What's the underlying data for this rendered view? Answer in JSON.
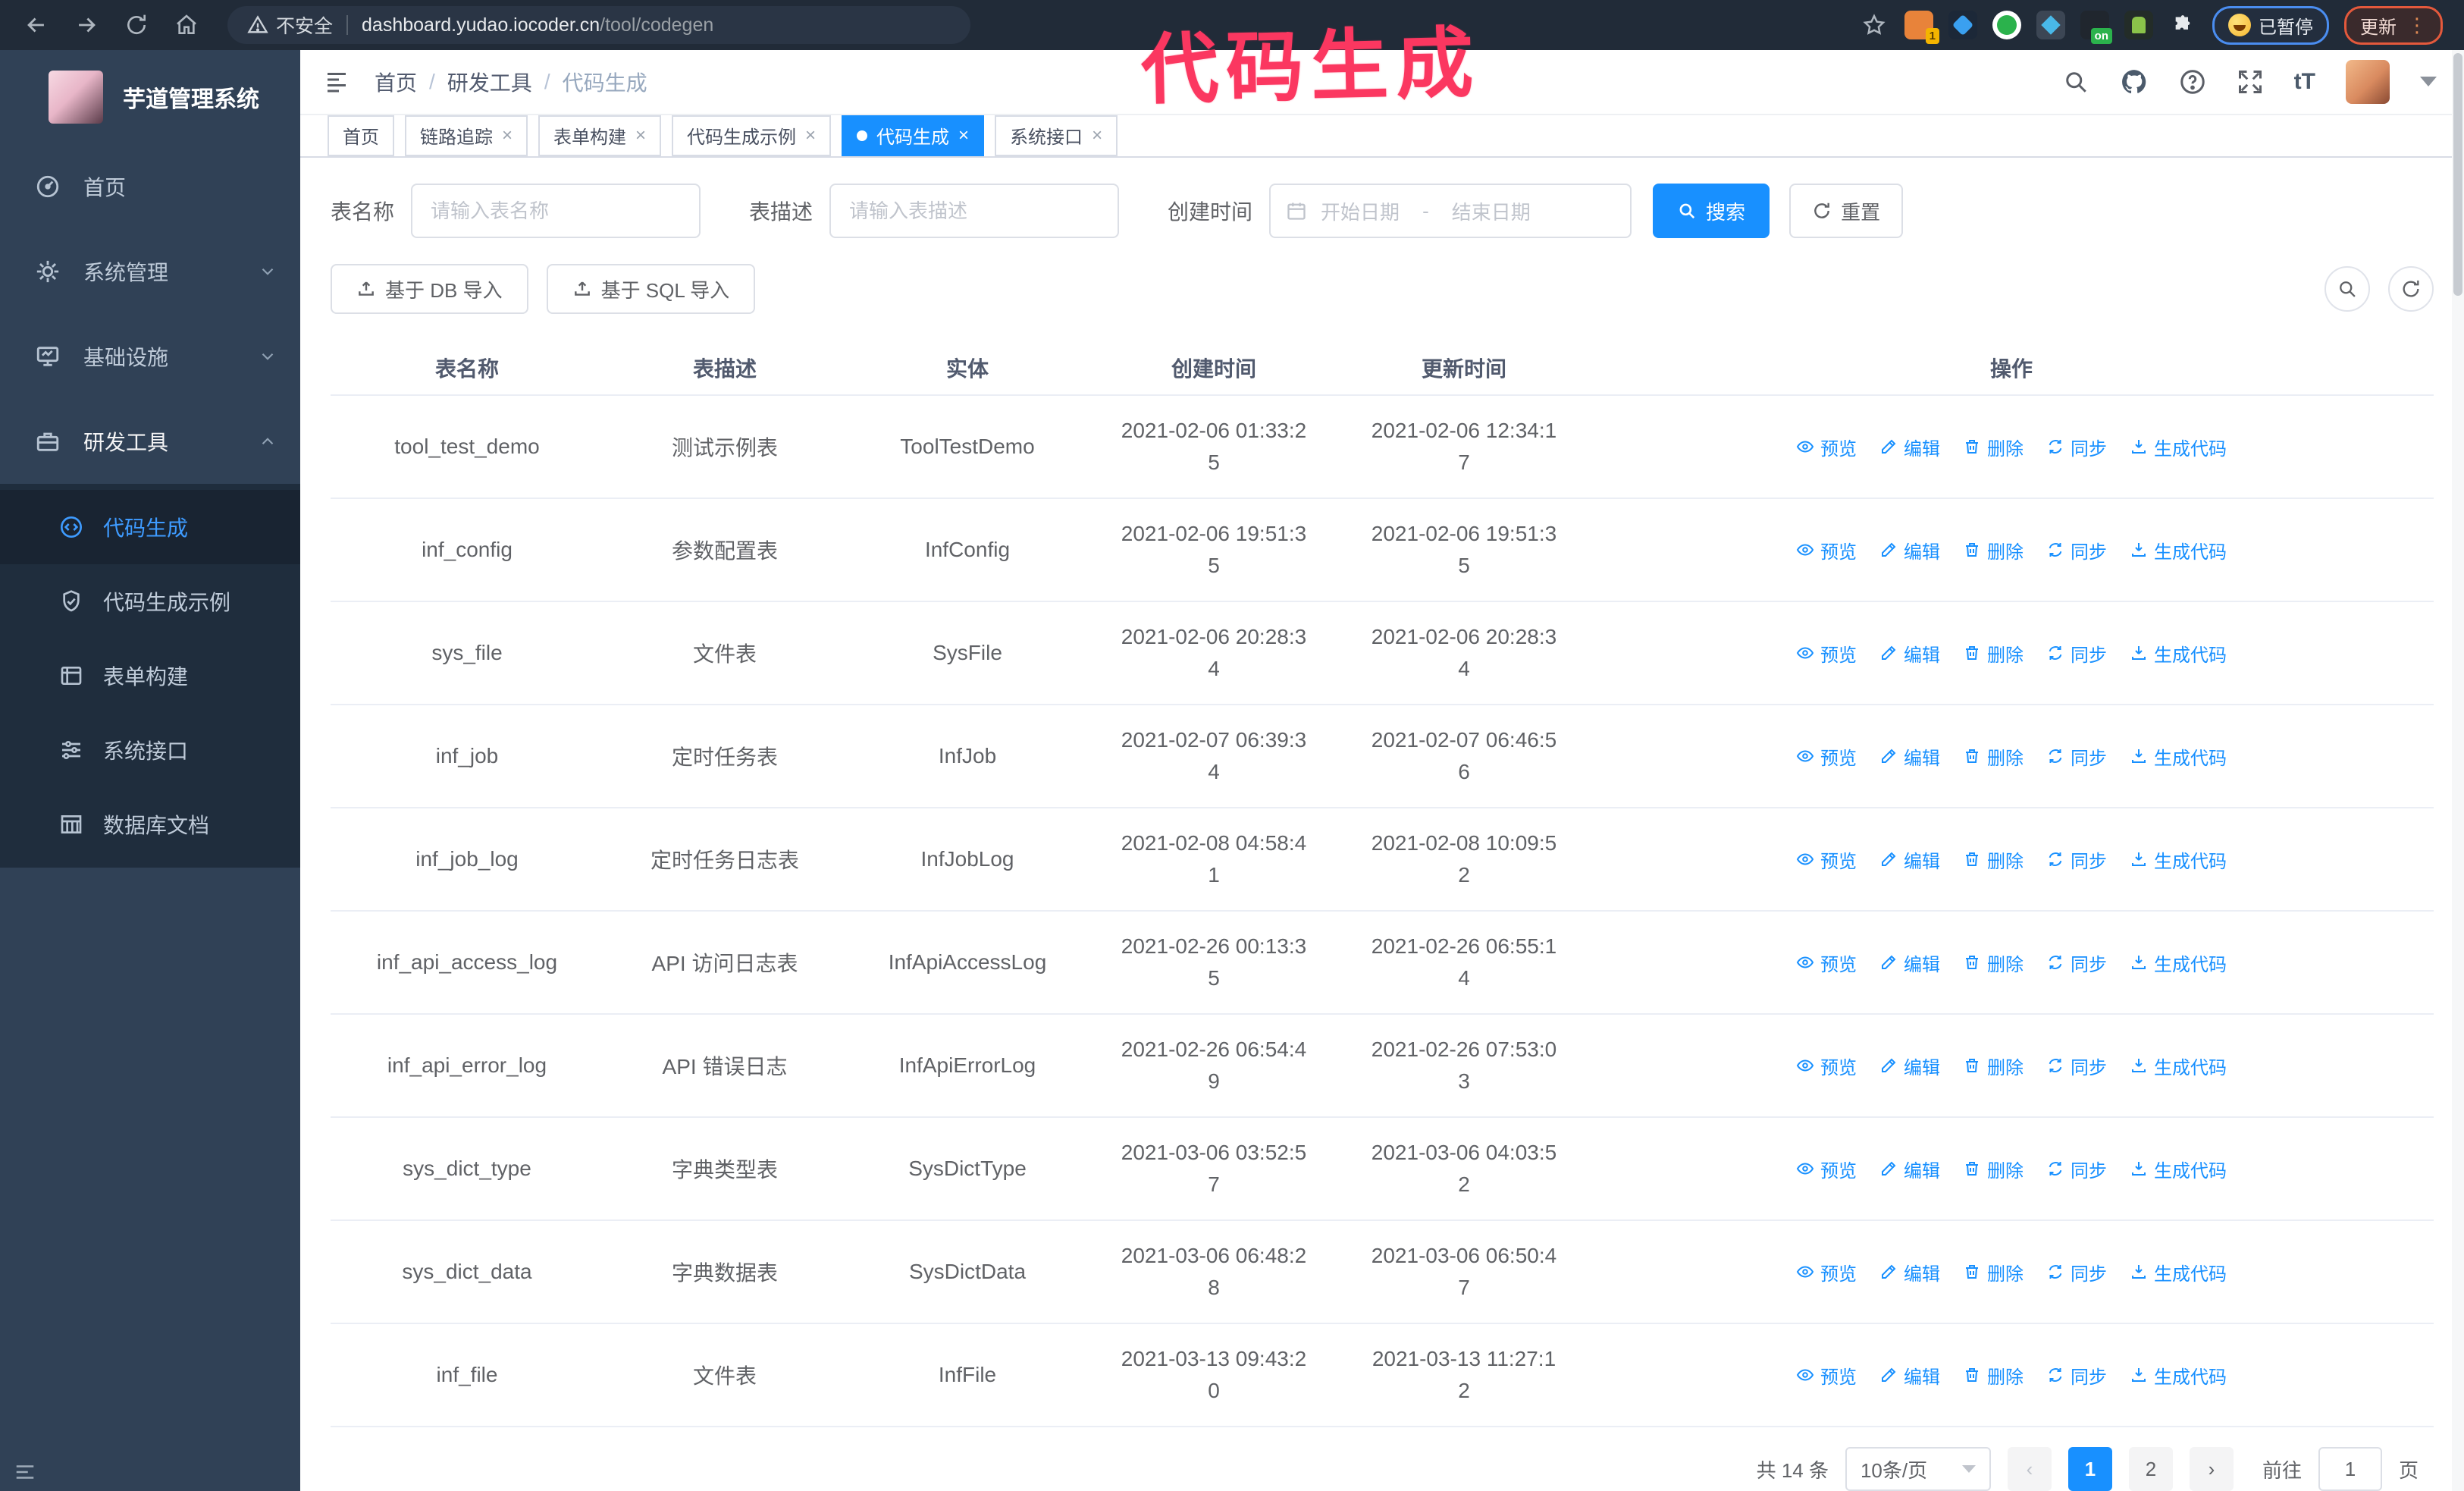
{
  "browser": {
    "security_label": "不安全",
    "url_host": "dashboard.yudao.iocoder.cn",
    "url_path": "/tool/codegen",
    "extension_badge_count": "1",
    "extension_badge_on": "on",
    "paused_badge": "已暂停",
    "update_button": "更新"
  },
  "annotation": {
    "text": "代码生成",
    "color": "#fb3760"
  },
  "sidebar": {
    "title": "芋道管理系统",
    "items": [
      {
        "label": "首页"
      },
      {
        "label": "系统管理"
      },
      {
        "label": "基础设施"
      },
      {
        "label": "研发工具"
      }
    ],
    "submenu": [
      {
        "label": "代码生成"
      },
      {
        "label": "代码生成示例"
      },
      {
        "label": "表单构建"
      },
      {
        "label": "系统接口"
      },
      {
        "label": "数据库文档"
      }
    ]
  },
  "navbar": {
    "breadcrumb": [
      "首页",
      "研发工具",
      "代码生成"
    ]
  },
  "tabs": [
    {
      "label": "首页"
    },
    {
      "label": "链路追踪"
    },
    {
      "label": "表单构建"
    },
    {
      "label": "代码生成示例"
    },
    {
      "label": "代码生成"
    },
    {
      "label": "系统接口"
    }
  ],
  "filters": {
    "table_name_label": "表名称",
    "table_name_placeholder": "请输入表名称",
    "table_desc_label": "表描述",
    "table_desc_placeholder": "请输入表描述",
    "create_time_label": "创建时间",
    "date_start_placeholder": "开始日期",
    "date_separator": "-",
    "date_end_placeholder": "结束日期",
    "search_button": "搜索",
    "reset_button": "重置"
  },
  "toolbar": {
    "import_db_button": "基于 DB 导入",
    "import_sql_button": "基于 SQL 导入"
  },
  "table": {
    "columns": [
      "表名称",
      "表描述",
      "实体",
      "创建时间",
      "更新时间",
      "操作"
    ],
    "actions": [
      "预览",
      "编辑",
      "删除",
      "同步",
      "生成代码"
    ],
    "rows": [
      {
        "name": "tool_test_demo",
        "desc": "测试示例表",
        "entity": "ToolTestDemo",
        "create_time": "2021-02-06 01:33:25",
        "update_time": "2021-02-06 12:34:17"
      },
      {
        "name": "inf_config",
        "desc": "参数配置表",
        "entity": "InfConfig",
        "create_time": "2021-02-06 19:51:35",
        "update_time": "2021-02-06 19:51:35"
      },
      {
        "name": "sys_file",
        "desc": "文件表",
        "entity": "SysFile",
        "create_time": "2021-02-06 20:28:34",
        "update_time": "2021-02-06 20:28:34"
      },
      {
        "name": "inf_job",
        "desc": "定时任务表",
        "entity": "InfJob",
        "create_time": "2021-02-07 06:39:34",
        "update_time": "2021-02-07 06:46:56"
      },
      {
        "name": "inf_job_log",
        "desc": "定时任务日志表",
        "entity": "InfJobLog",
        "create_time": "2021-02-08 04:58:41",
        "update_time": "2021-02-08 10:09:52"
      },
      {
        "name": "inf_api_access_log",
        "desc": "API 访问日志表",
        "entity": "InfApiAccessLog",
        "create_time": "2021-02-26 00:13:35",
        "update_time": "2021-02-26 06:55:14"
      },
      {
        "name": "inf_api_error_log",
        "desc": "API 错误日志",
        "entity": "InfApiErrorLog",
        "create_time": "2021-02-26 06:54:49",
        "update_time": "2021-02-26 07:53:03"
      },
      {
        "name": "sys_dict_type",
        "desc": "字典类型表",
        "entity": "SysDictType",
        "create_time": "2021-03-06 03:52:57",
        "update_time": "2021-03-06 04:03:52"
      },
      {
        "name": "sys_dict_data",
        "desc": "字典数据表",
        "entity": "SysDictData",
        "create_time": "2021-03-06 06:48:28",
        "update_time": "2021-03-06 06:50:47"
      },
      {
        "name": "inf_file",
        "desc": "文件表",
        "entity": "InfFile",
        "create_time": "2021-03-13 09:43:20",
        "update_time": "2021-03-13 11:27:12"
      }
    ]
  },
  "pagination": {
    "total": "共 14 条",
    "page_size": "10条/页",
    "page_1": "1",
    "page_2": "2",
    "goto_label": "前往",
    "goto_value": "1",
    "page_suffix": "页"
  },
  "colors": {
    "primary": "#1890ff",
    "sidebar_bg": "#304156",
    "submenu_bg": "#1f2d3d",
    "chrome_bg": "#212b38",
    "annotation_pink": "#fb3760",
    "paused_border": "#4a8df0",
    "update_accent": "#e4593c"
  }
}
